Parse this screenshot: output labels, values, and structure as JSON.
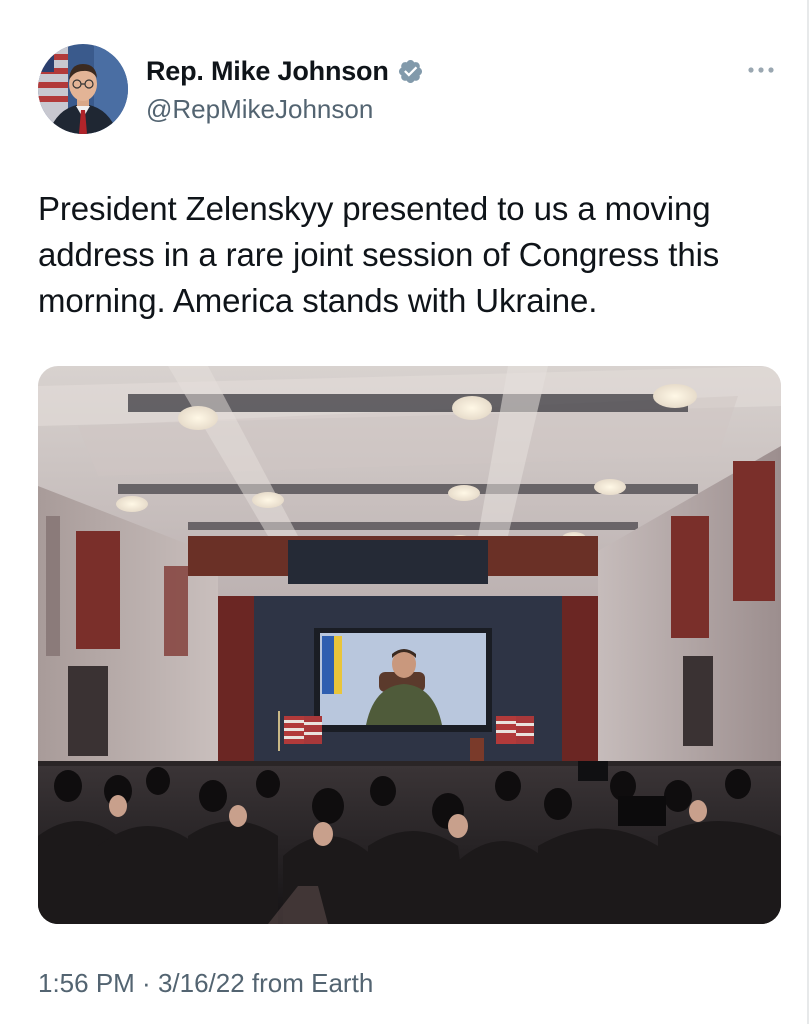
{
  "tweet": {
    "author": {
      "display_name": "Rep. Mike Johnson",
      "handle": "@RepMikeJohnson",
      "verified": true
    },
    "text": "President Zelenskyy presented to us a moving\naddress in a rare joint session of Congress this\nmorning. America stands with Ukraine.",
    "time": "1:56 PM",
    "separator": " · ",
    "date": "3/16/22",
    "source": " from Earth"
  },
  "icons": {
    "verified": "verified-badge-icon",
    "more": "more-options-icon"
  },
  "colors": {
    "text": "#0f1419",
    "secondary": "#536471",
    "verified_badge": "#829aab"
  }
}
